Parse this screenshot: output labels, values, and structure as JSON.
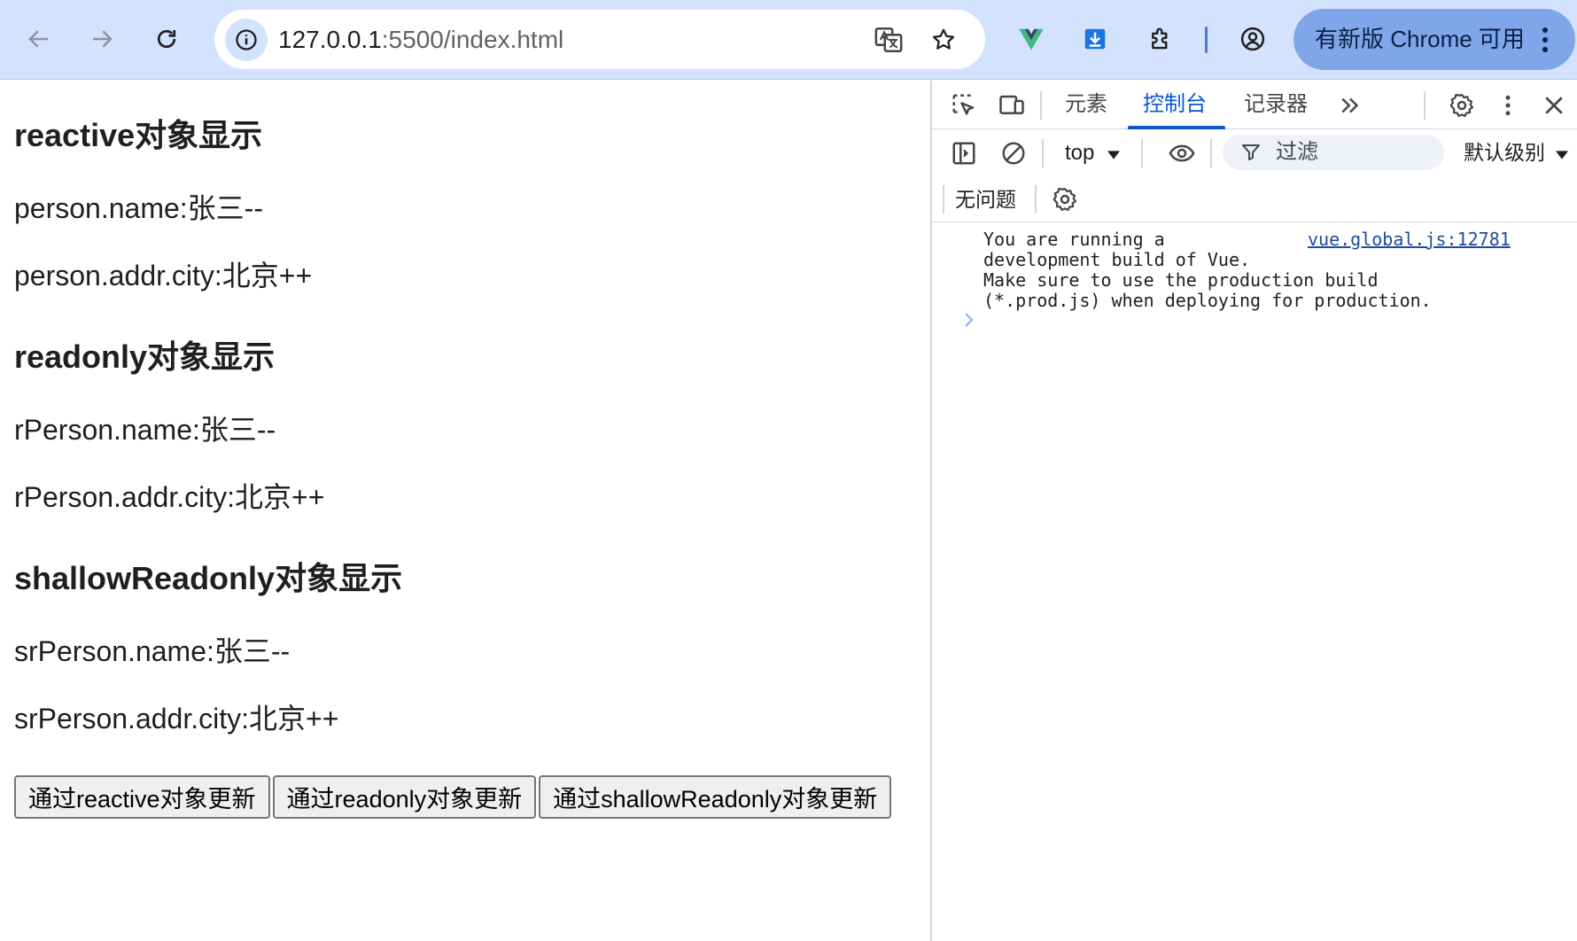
{
  "browser": {
    "url_host": "127.0.0.1",
    "url_path": ":5500/index.html",
    "update_label": "有新版 Chrome 可用",
    "icons": [
      "back-arrow-icon",
      "forward-arrow-icon",
      "reload-icon",
      "site-info-icon",
      "translate-icon",
      "bookmark-star-icon",
      "vue-devtools-icon",
      "download-icon",
      "extensions-puzzle-icon",
      "profile-icon",
      "more-vert-icon"
    ]
  },
  "page": {
    "sections": [
      {
        "heading": "reactive对象显示",
        "lines": [
          "person.name:张三--",
          "person.addr.city:北京++"
        ]
      },
      {
        "heading": "readonly对象显示",
        "lines": [
          "rPerson.name:张三--",
          "rPerson.addr.city:北京++"
        ]
      },
      {
        "heading": "shallowReadonly对象显示",
        "lines": [
          "srPerson.name:张三--",
          "srPerson.addr.city:北京++"
        ]
      }
    ],
    "buttons": [
      "通过reactive对象更新",
      "通过readonly对象更新",
      "通过shallowReadonly对象更新"
    ]
  },
  "devtools": {
    "tabs": [
      "元素",
      "控制台",
      "记录器"
    ],
    "active_tab": "控制台",
    "context": "top",
    "filter_placeholder": "过滤",
    "levels": "默认级别",
    "issues": "无问题",
    "console": {
      "message_lines": [
        "You are running a",
        "development build of Vue.",
        "Make sure to use the production build",
        "(*.prod.js) when deploying for production."
      ],
      "source": "vue.global.js:12781"
    },
    "accent": "#0b57d0"
  }
}
